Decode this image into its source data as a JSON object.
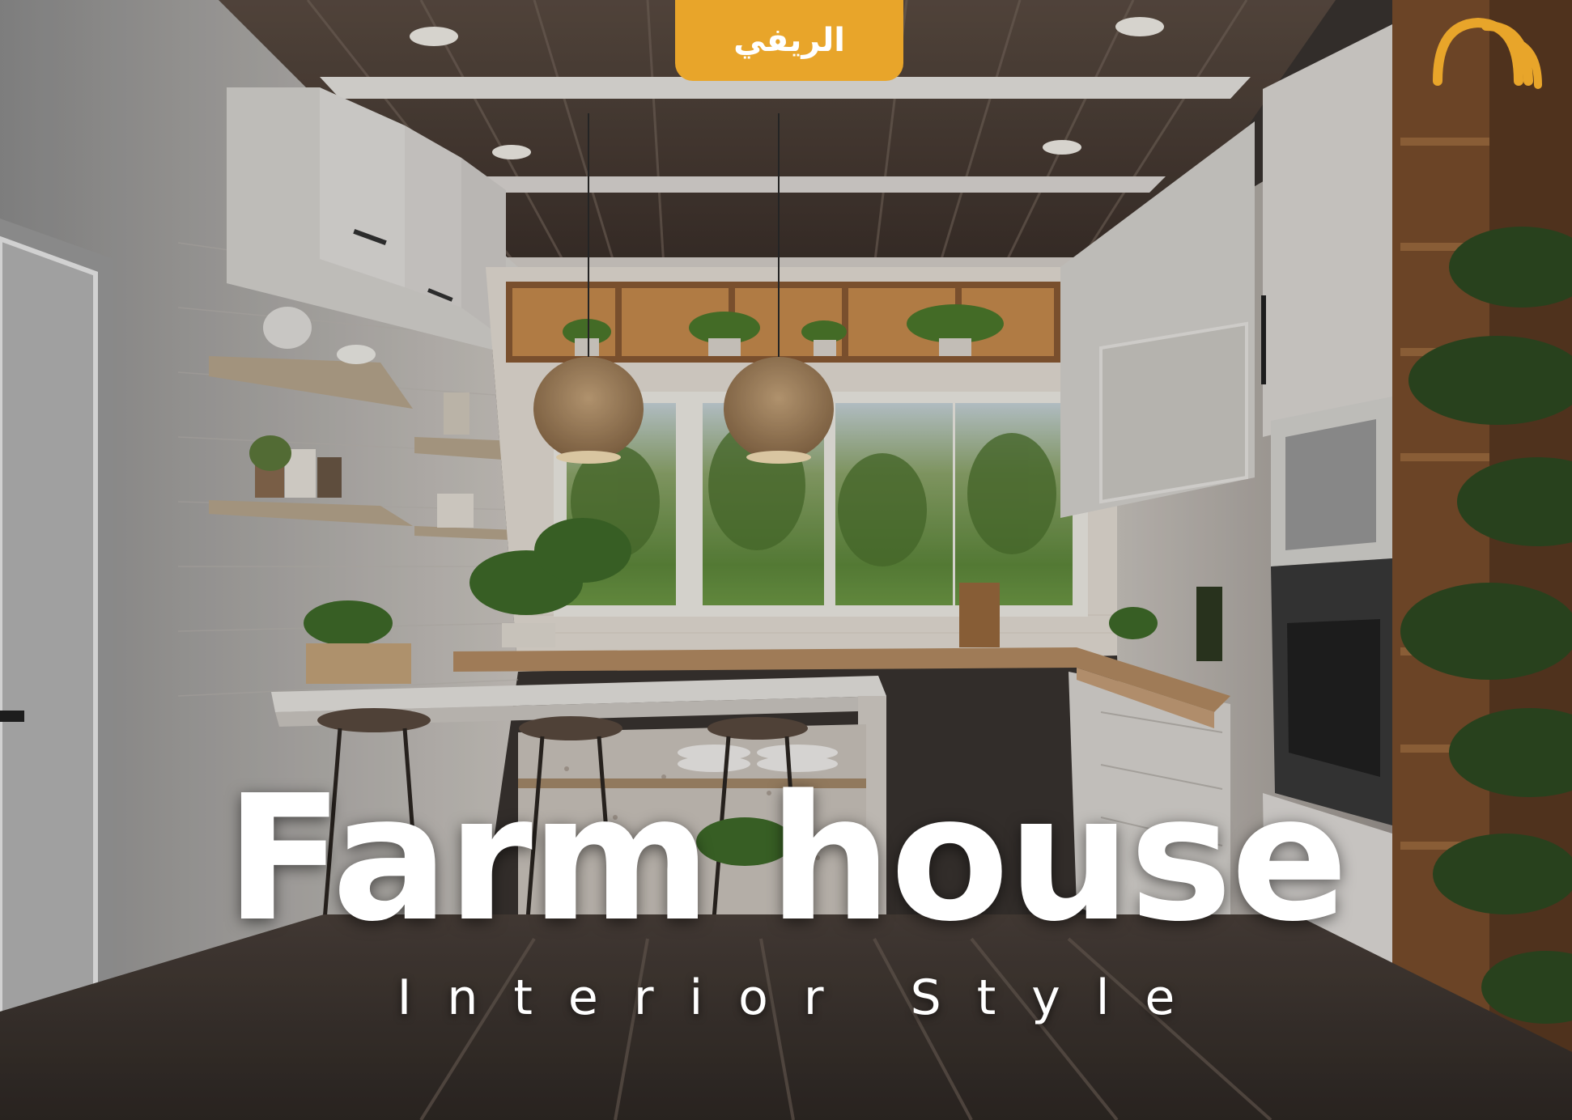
{
  "badge": {
    "label": "الريفي"
  },
  "headline": {
    "title": "Farm house",
    "subtitle": "Interior Style"
  },
  "colors": {
    "accent": "#e8a52a",
    "text": "#ffffff"
  },
  "icons": {
    "logo": "arch-lines-logo"
  }
}
